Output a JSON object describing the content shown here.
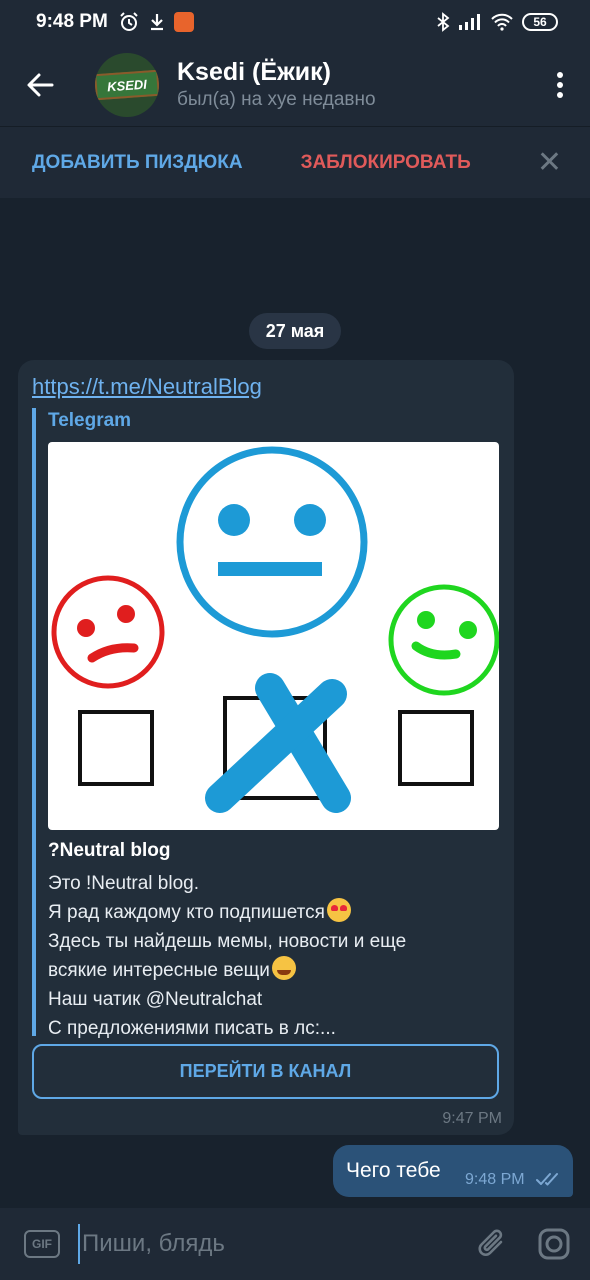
{
  "status_bar": {
    "time": "9:48 PM",
    "battery": "56",
    "icons_left": [
      "alarm-icon",
      "download-icon",
      "app-notification-icon"
    ],
    "icons_right": [
      "bluetooth-icon",
      "signal-icon",
      "wifi-icon",
      "battery-icon"
    ]
  },
  "header": {
    "title": "Ksedi (Ёжик)",
    "subtitle": "был(а) на хуе недавно",
    "avatar_text": "KSEDI"
  },
  "action_bar": {
    "add_label": "ДОБАВИТЬ ПИЗДЮКА",
    "block_label": "ЗАБЛОКИРОВАТЬ",
    "close_glyph": "✕"
  },
  "date_label": "27 мая",
  "incoming_message": {
    "link": "https://t.me/NeutralBlog",
    "preview": {
      "site_name": "Telegram",
      "title": "?Neutral blog",
      "description_lines": [
        "Это !Neutral blog.",
        "Я рад каждому кто подпишется",
        "Здесь ты найдешь мемы, новости и еще",
        "всякие интересные вещи",
        "Наш чатик @Neutralchat",
        "С предложениями писать в лс:..."
      ]
    },
    "button_label": "ПЕРЕЙТИ В КАНАЛ",
    "time": "9:47 PM"
  },
  "outgoing_message": {
    "text": "Чего тебе",
    "time": "9:48 PM",
    "status": "read"
  },
  "input_bar": {
    "gif_label": "GIF",
    "placeholder": "Пиши, блядь"
  },
  "colors": {
    "background": "#18222d",
    "header": "#1f2936",
    "accent": "#5fa8e6",
    "danger": "#e05a5a",
    "incoming_bubble": "#222e3a",
    "outgoing_bubble": "#2b5278"
  }
}
